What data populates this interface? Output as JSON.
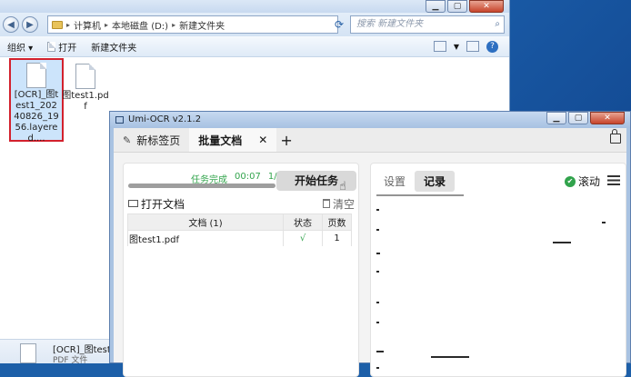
{
  "explorer": {
    "breadcrumb": [
      "计算机",
      "本地磁盘 (D:)",
      "新建文件夹"
    ],
    "search_placeholder": "搜索 新建文件夹",
    "toolbar": {
      "organize": "组织 ▾",
      "open": "打开",
      "new_folder": "新建文件夹"
    },
    "files": [
      {
        "name": "[OCR]_图test1_20240826_1956.layered....",
        "selected": true
      },
      {
        "name": "图test1.pdf",
        "selected": false
      }
    ],
    "details": {
      "name": "[OCR]_图test1",
      "type": "PDF 文件"
    }
  },
  "umi": {
    "title": "Umi-OCR v2.1.2",
    "tabs": [
      {
        "label": "新标签页",
        "active": false
      },
      {
        "label": "批量文档",
        "active": true
      }
    ],
    "add_tab": "+",
    "close_tab": "✕",
    "progress": {
      "label": "任务完成",
      "time": "00:07",
      "count": "1/1",
      "fraction": 1.0
    },
    "start_button": "开始任务",
    "open_docs": "打开文档",
    "clear": "清空",
    "table": {
      "headers": [
        "文档 (1)",
        "状态",
        "页数"
      ],
      "rows": [
        {
          "doc": "图test1.pdf",
          "status": "√",
          "pages": "1"
        }
      ]
    },
    "right_tabs": [
      {
        "label": "设置",
        "active": false
      },
      {
        "label": "记录",
        "active": true
      }
    ],
    "scroll_label": "滚动"
  },
  "icons": {
    "pin": "pin-icon",
    "lock": "lock-icon",
    "folder": "folder-open-icon",
    "trash": "trash-icon",
    "check": "check-circle-icon",
    "menu": "menu-icon",
    "cursor": "hand-cursor-icon"
  },
  "colors": {
    "success": "#34a54e",
    "selection_border": "#d3212d"
  }
}
